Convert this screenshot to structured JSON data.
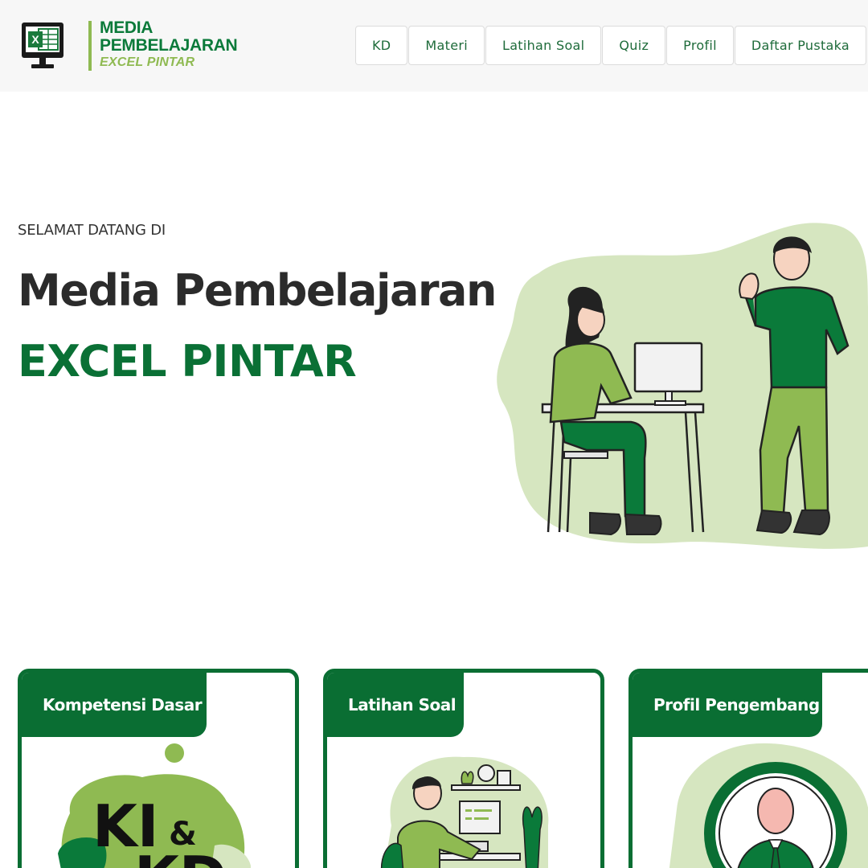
{
  "header": {
    "logo_line1": "MEDIA",
    "logo_line2": "PEMBELAJARAN",
    "logo_line3": "EXCEL PINTAR",
    "logo_icon_letter": "X"
  },
  "nav": {
    "items": [
      {
        "label": "KD"
      },
      {
        "label": "Materi"
      },
      {
        "label": "Latihan Soal"
      },
      {
        "label": "Quiz"
      },
      {
        "label": "Profil"
      },
      {
        "label": "Daftar Pustaka"
      }
    ]
  },
  "hero": {
    "welcome": "SELAMAT DATANG DI",
    "title_line1": "Media Pembelajaran",
    "title_line2": "EXCEL PINTAR"
  },
  "cards": [
    {
      "title": "Kompetensi Dasar",
      "art_text_main": "KI",
      "art_text_amp": "&",
      "art_text_sub": "KD"
    },
    {
      "title": "Latihan Soal"
    },
    {
      "title": "Profil Pengembang"
    }
  ],
  "colors": {
    "primary_green": "#0a6e33",
    "accent_green": "#8fba52",
    "light_green": "#d6e6c0",
    "header_bg": "#f7f7f7"
  }
}
